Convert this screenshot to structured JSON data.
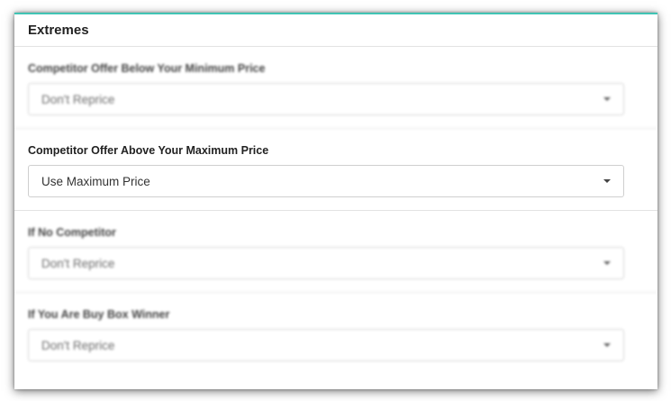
{
  "panel": {
    "title": "Extremes"
  },
  "rules": [
    {
      "label": "Competitor Offer Below Your Minimum Price",
      "value": "Don't Reprice",
      "blurred": true
    },
    {
      "label": "Competitor Offer Above Your Maximum Price",
      "value": "Use Maximum Price",
      "blurred": false
    },
    {
      "label": "If No Competitor",
      "value": "Don't Reprice",
      "blurred": true
    },
    {
      "label": "If You Are Buy Box Winner",
      "value": "Don't Reprice",
      "blurred": true
    }
  ],
  "colors": {
    "accent": "#40c4b4"
  }
}
